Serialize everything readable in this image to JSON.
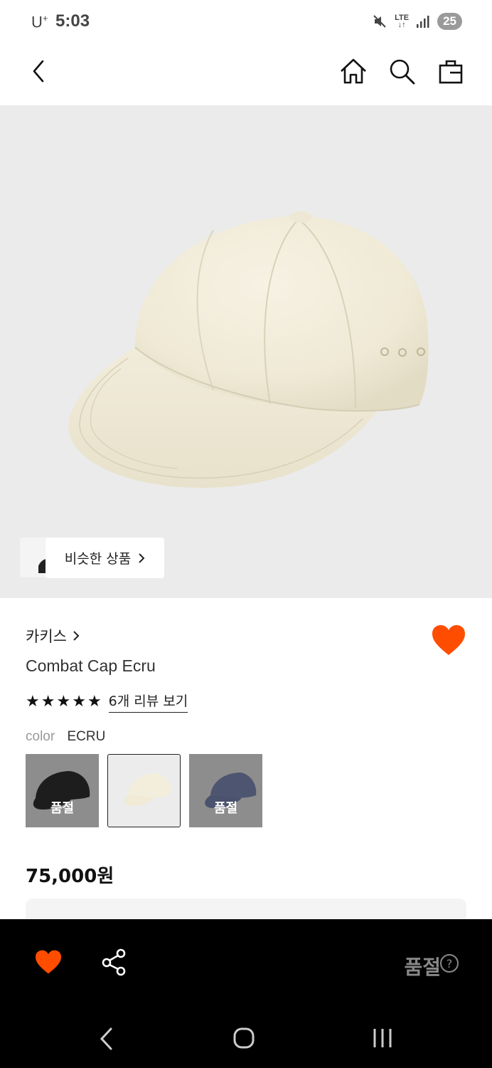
{
  "status_bar": {
    "carrier": "U",
    "carrier_plus": "+",
    "time": "5:03",
    "network": "LTE",
    "battery": "25"
  },
  "nav": {
    "icons": [
      "back-icon",
      "home-icon",
      "search-icon",
      "shopping-bag-icon"
    ]
  },
  "hero": {
    "similar_label": "비슷한 상품"
  },
  "product": {
    "brand": "카키스",
    "name": "Combat Cap Ecru",
    "rating_stars": 5,
    "review_link": "6개 리뷰 보기",
    "color_label": "color",
    "color_value": "ECRU",
    "swatches": [
      {
        "color": "black",
        "soldout_label": "품절"
      },
      {
        "color": "ecru",
        "soldout_label": ""
      },
      {
        "color": "navy",
        "soldout_label": "품절"
      }
    ],
    "price": "75,000원",
    "favorited": true
  },
  "action_bar": {
    "status": "품절",
    "accent": "#ff4d00"
  },
  "colors": {
    "accent": "#ff4d00",
    "hero_bg": "#ebebeb"
  }
}
